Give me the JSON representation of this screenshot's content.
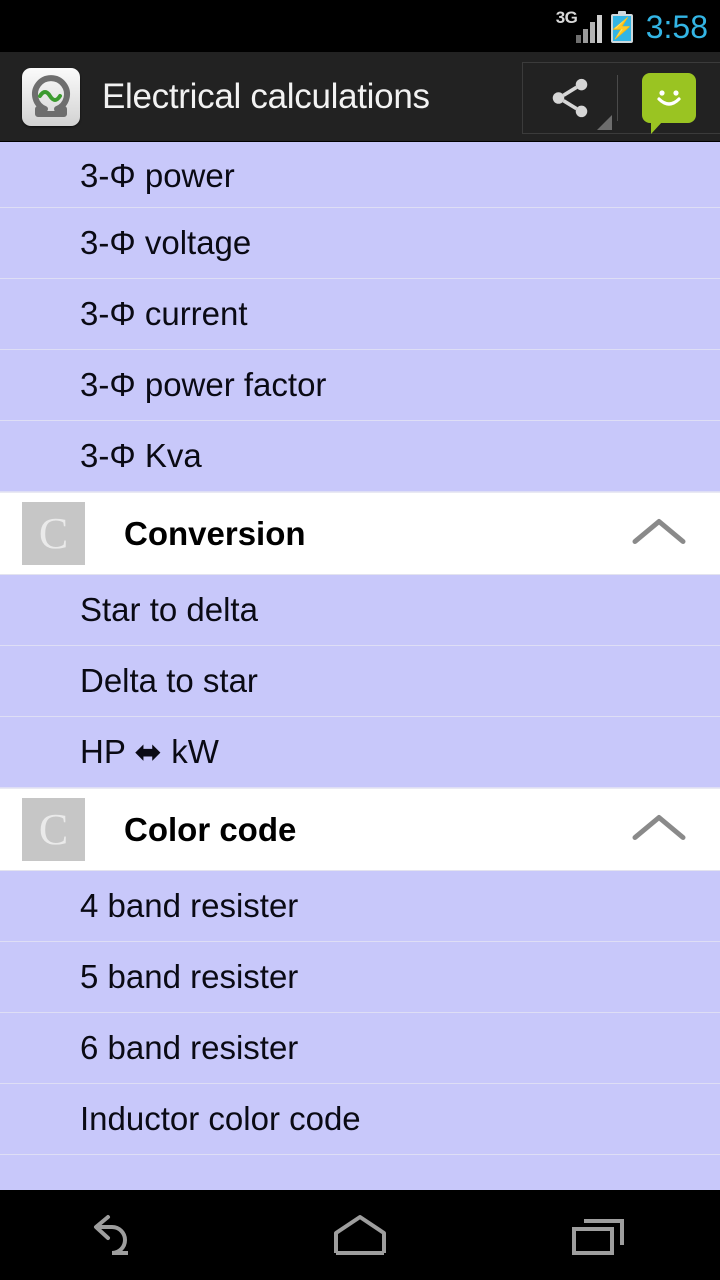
{
  "status_bar": {
    "network_label": "3G",
    "network_icon": "signal-bars-icon",
    "battery_icon": "battery-charging-icon",
    "time": "3:58",
    "clock_color": "#33b5e5"
  },
  "action_bar": {
    "app_icon": "omega-sine-app-icon",
    "title": "Electrical calculations",
    "background": "#222222",
    "actions": [
      {
        "name": "share-button",
        "icon": "share-icon",
        "has_dropdown": true
      },
      {
        "name": "sms-button",
        "icon": "sms-smiley-icon",
        "color": "#9ac422"
      }
    ]
  },
  "list": {
    "row_background": "#C8C8FA",
    "header_background": "#ffffff",
    "groups": [
      {
        "header": null,
        "items": [
          {
            "label": "3-Φ power",
            "clipped_top": true
          },
          {
            "label": "3-Φ voltage"
          },
          {
            "label": "3-Φ current"
          },
          {
            "label": "3-Φ power factor"
          },
          {
            "label": "3-Φ Kva"
          }
        ]
      },
      {
        "header": {
          "badge": "C",
          "title": "Conversion",
          "expanded": true,
          "toggle_icon": "chevron-up-icon"
        },
        "items": [
          {
            "label": "Star to delta"
          },
          {
            "label": "Delta to star"
          },
          {
            "label": "HP ⬌ kW"
          }
        ]
      },
      {
        "header": {
          "badge": "C",
          "title": "Color code",
          "expanded": true,
          "toggle_icon": "chevron-up-icon"
        },
        "items": [
          {
            "label": "4 band resister"
          },
          {
            "label": "5 band resister"
          },
          {
            "label": "6 band resister"
          },
          {
            "label": "Inductor color code",
            "clipped_bottom": true
          }
        ]
      }
    ]
  },
  "nav_bar": {
    "buttons": [
      {
        "name": "back-button",
        "icon": "back-arrow-icon"
      },
      {
        "name": "home-button",
        "icon": "home-icon"
      },
      {
        "name": "recents-button",
        "icon": "recent-apps-icon"
      }
    ]
  }
}
